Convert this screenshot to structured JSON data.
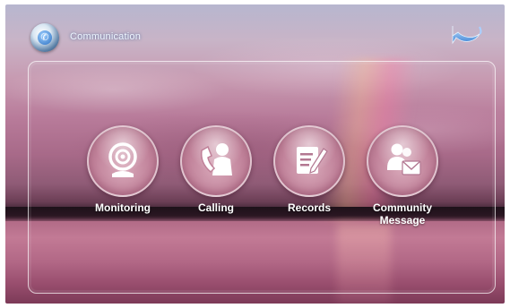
{
  "header": {
    "title": "Communication",
    "logo_icon": "phone-globe-icon",
    "back_icon": "return-arrow-icon"
  },
  "menu": [
    {
      "label": "Monitoring",
      "icon": "webcam-icon"
    },
    {
      "label": "Calling",
      "icon": "handset-person-icon"
    },
    {
      "label": "Records",
      "icon": "notepad-pen-icon"
    },
    {
      "label": "Community\nMessage",
      "icon": "people-envelope-icon"
    }
  ],
  "colors": {
    "accent": "#2a6fc2",
    "icon_white": "#ffffff",
    "tile": "#c08199"
  }
}
